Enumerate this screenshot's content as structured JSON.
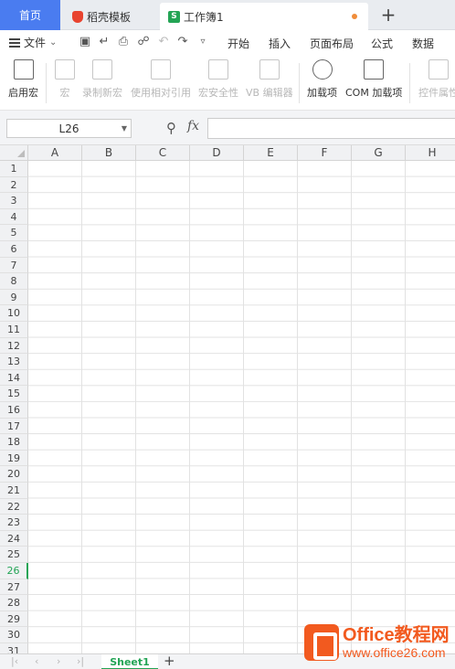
{
  "tabs": {
    "home": "首页",
    "daoke": "稻壳模板",
    "workbook": "工作簿1",
    "workbook_icon": "S",
    "add": "+"
  },
  "menu": {
    "file": "文件",
    "items": [
      "开始",
      "插入",
      "页面布局",
      "公式",
      "数据"
    ]
  },
  "ribbon": {
    "items": [
      {
        "label": "启用宏",
        "icon": "enable-macro-icon",
        "enabled": true
      },
      {
        "label": "宏",
        "icon": "macro-icon",
        "enabled": false
      },
      {
        "label": "录制新宏",
        "icon": "record-macro-icon",
        "enabled": false
      },
      {
        "label": "使用相对引用",
        "icon": "relative-reference-icon",
        "enabled": false
      },
      {
        "label": "宏安全性",
        "icon": "macro-security-icon",
        "enabled": false
      },
      {
        "label": "VB 编辑器",
        "icon": "vb-editor-icon",
        "enabled": false
      },
      {
        "label": "加载项",
        "icon": "addins-icon",
        "enabled": true
      },
      {
        "label": "COM 加载项",
        "icon": "com-addins-icon",
        "enabled": true
      },
      {
        "label": "控件属性",
        "icon": "control-properties-icon",
        "enabled": false
      }
    ]
  },
  "formula_bar": {
    "name_box": "L26",
    "fx": "fx",
    "formula": ""
  },
  "grid": {
    "columns": [
      "A",
      "B",
      "C",
      "D",
      "E",
      "F",
      "G",
      "H"
    ],
    "rows": [
      "1",
      "2",
      "3",
      "4",
      "5",
      "6",
      "7",
      "8",
      "9",
      "10",
      "11",
      "12",
      "13",
      "14",
      "15",
      "16",
      "17",
      "18",
      "19",
      "20",
      "21",
      "22",
      "23",
      "24",
      "25",
      "26",
      "27",
      "28",
      "29",
      "30",
      "31"
    ],
    "active_row": "26"
  },
  "sheets": {
    "tabs": [
      "Sheet1"
    ],
    "add": "+"
  },
  "watermark": {
    "title": "Office教程网",
    "url": "www.office26.com"
  },
  "colors": {
    "accent": "#4a7cf0",
    "green": "#23a455",
    "watermark": "#f25a1f"
  }
}
